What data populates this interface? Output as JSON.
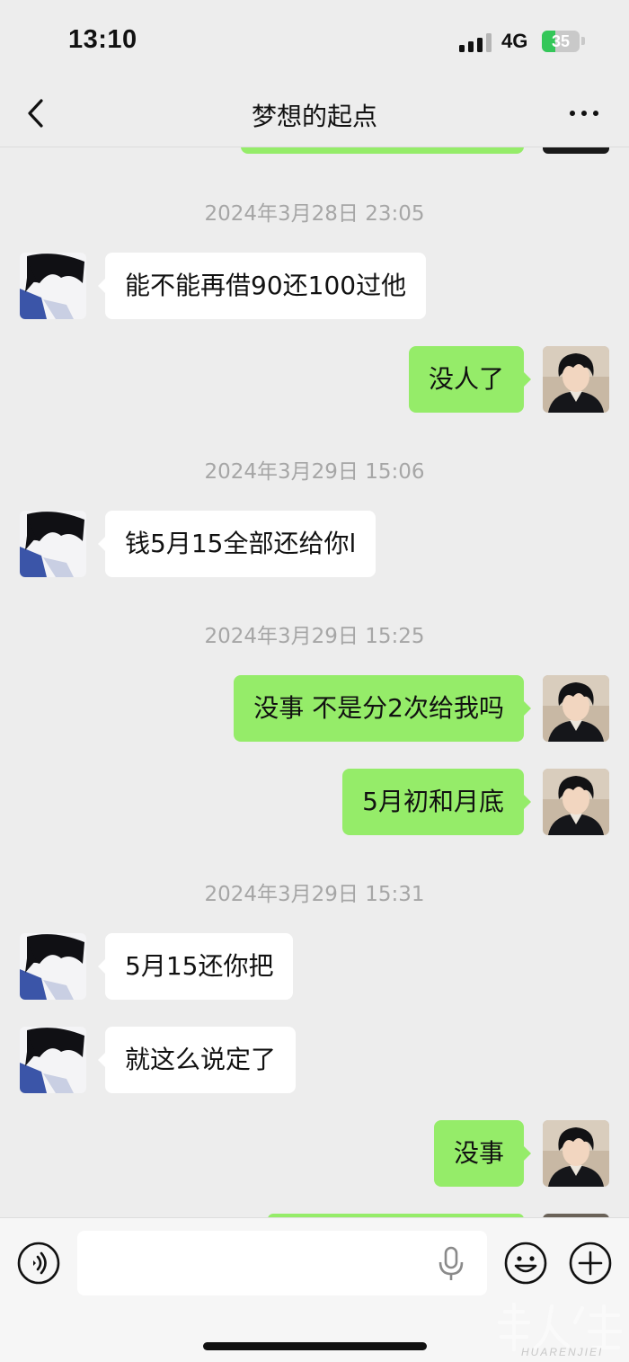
{
  "status_bar": {
    "time": "13:10",
    "network": "4G",
    "battery_percent": "35",
    "battery_level": 0.35
  },
  "nav": {
    "title": "梦想的起点",
    "back_icon": "chevron-left-icon",
    "more_icon": "ellipsis-icon"
  },
  "messages": [
    {
      "type": "timestamp",
      "text": "2024年3月28日 23:05"
    },
    {
      "type": "received",
      "text": "能不能再借90还100过他"
    },
    {
      "type": "sent",
      "text": "没人了"
    },
    {
      "type": "timestamp",
      "text": "2024年3月29日 15:06"
    },
    {
      "type": "received",
      "text": "钱5月15全部还给你l"
    },
    {
      "type": "timestamp",
      "text": "2024年3月29日 15:25"
    },
    {
      "type": "sent",
      "text": "没事  不是分2次给我吗"
    },
    {
      "type": "sent",
      "text": "5月初和月底"
    },
    {
      "type": "timestamp",
      "text": "2024年3月29日 15:31"
    },
    {
      "type": "received",
      "text": "5月15还你把"
    },
    {
      "type": "received",
      "text": "就这么说定了"
    },
    {
      "type": "sent",
      "text": "没事"
    }
  ],
  "input_bar": {
    "text_value": "",
    "voice_icon": "voice-mode-icon",
    "mic_icon": "microphone-icon",
    "emoji_icon": "emoji-icon",
    "plus_icon": "plus-circle-icon"
  },
  "watermark": {
    "logo": "华人街",
    "text": "HUARENJIEI"
  },
  "colors": {
    "background": "#ededed",
    "sent_bubble": "#95ec69",
    "received_bubble": "#ffffff",
    "timestamp_text": "#a6a6a6"
  }
}
